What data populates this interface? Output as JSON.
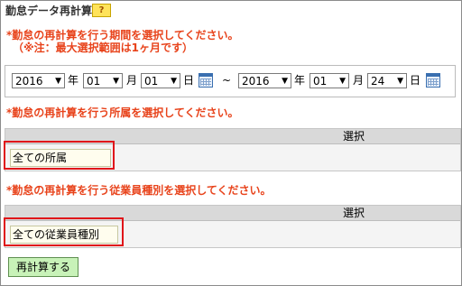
{
  "header": {
    "title": "勤怠データ再計算",
    "help_icon_label": "?"
  },
  "period_note": {
    "line1": "*勤怠の再計算を行う期間を選択してください。",
    "line2": "（※注：最大選択範囲は1ヶ月です）"
  },
  "period": {
    "from": {
      "year": "2016",
      "month": "01",
      "day": "01"
    },
    "to": {
      "year": "2016",
      "month": "01",
      "day": "24"
    },
    "unit_year": "年",
    "unit_month": "月",
    "unit_day": "日",
    "separator": "~"
  },
  "department": {
    "note": "*勤怠の再計算を行う所属を選択してください。",
    "column_header": "選択",
    "value": "全ての所属"
  },
  "employee_type": {
    "note": "*勤怠の再計算を行う従業員種別を選択してください。",
    "column_header": "選択",
    "value": "全ての従業員種別"
  },
  "actions": {
    "recalc_button": "再計算する"
  },
  "colors": {
    "accent_note": "#e8431b",
    "highlight": "#e0161a",
    "button_bg": "#c8f2b8"
  }
}
